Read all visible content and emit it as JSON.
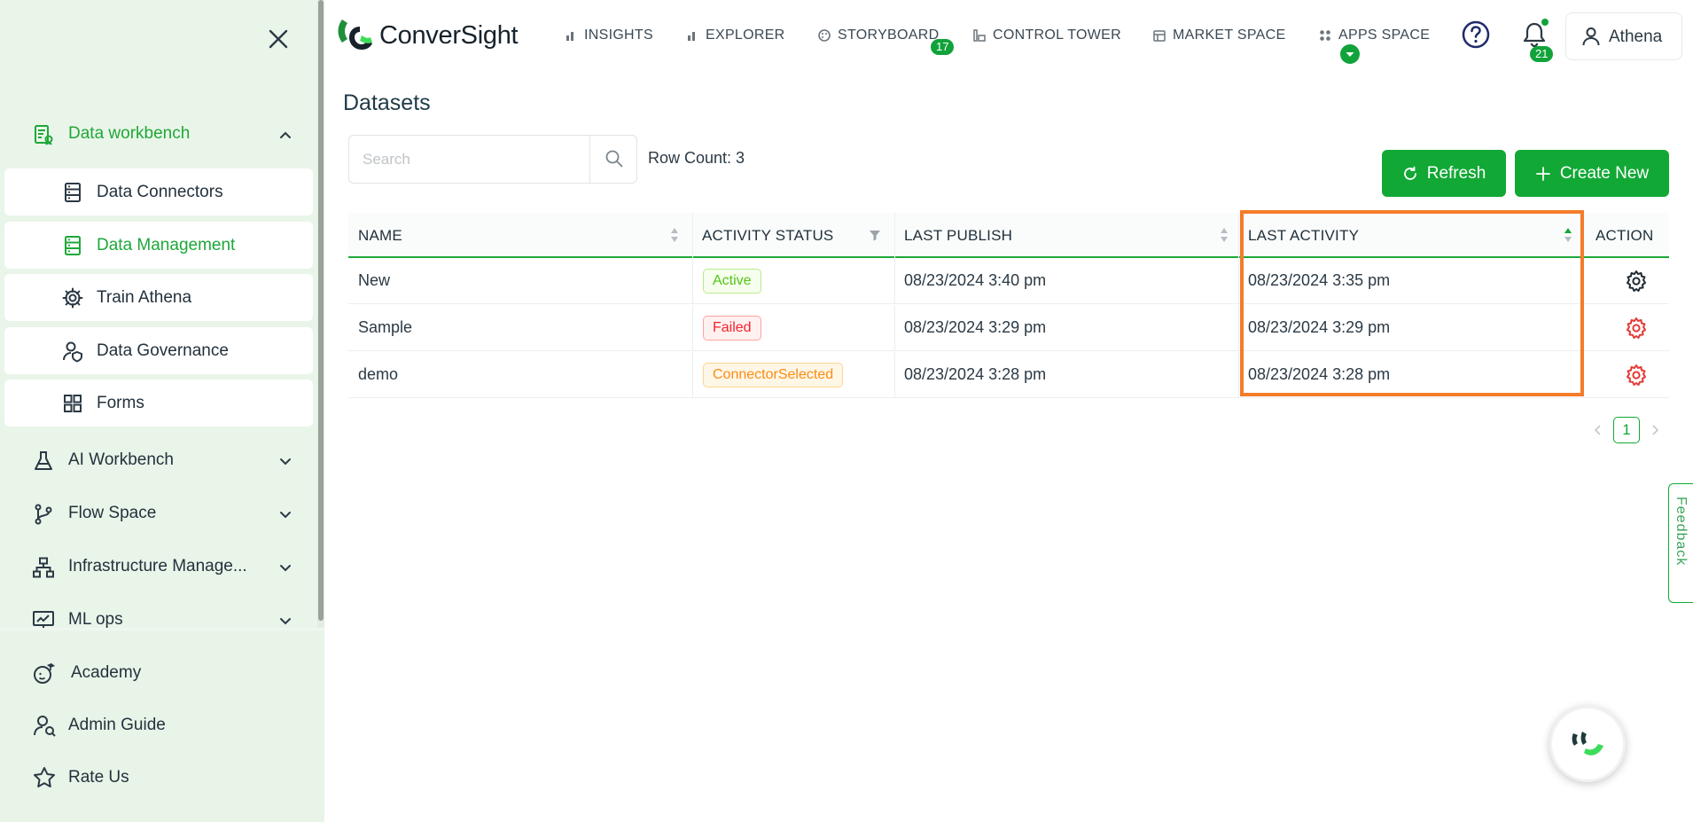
{
  "sidebar": {
    "groups": [
      {
        "label": "Data workbench",
        "icon": "data-workbench-icon",
        "open": true
      },
      {
        "label": "AI Workbench",
        "icon": "flask-icon"
      },
      {
        "label": "Flow Space",
        "icon": "branch-icon"
      },
      {
        "label": "Infrastructure Manage...",
        "icon": "sitemap-icon"
      },
      {
        "label": "ML ops",
        "icon": "monitor-chart-icon"
      }
    ],
    "sub_items": [
      {
        "label": "Data Connectors",
        "icon": "server-icon"
      },
      {
        "label": "Data Management",
        "icon": "server-icon",
        "active": true
      },
      {
        "label": "Train Athena",
        "icon": "gear-icon"
      },
      {
        "label": "Data Governance",
        "icon": "user-shield-icon"
      },
      {
        "label": "Forms",
        "icon": "grid-icon"
      }
    ],
    "bottom_items": [
      {
        "label": "Academy",
        "icon": "academy-icon"
      },
      {
        "label": "Admin Guide",
        "icon": "admin-guide-icon"
      },
      {
        "label": "Rate Us",
        "icon": "star-icon"
      }
    ]
  },
  "header": {
    "logo_text": "ConverSight",
    "nav": [
      {
        "label": "INSIGHTS",
        "icon": "bar-chart-icon"
      },
      {
        "label": "EXPLORER",
        "icon": "bar-chart-icon"
      },
      {
        "label": "STORYBOARD",
        "icon": "palette-icon",
        "badge": "17"
      },
      {
        "label": "CONTROL TOWER",
        "icon": "tower-icon"
      },
      {
        "label": "MARKET SPACE",
        "icon": "store-icon"
      },
      {
        "label": "APPS SPACE",
        "icon": "apps-icon"
      }
    ],
    "notification_count": "21",
    "user_name": "Athena"
  },
  "main": {
    "title": "Datasets",
    "search_placeholder": "Search",
    "row_count": "Row Count: 3",
    "refresh_label": "Refresh",
    "create_label": "Create New",
    "columns": [
      "NAME",
      "ACTIVITY STATUS",
      "LAST PUBLISH",
      "LAST ACTIVITY",
      "ACTION"
    ],
    "rows": [
      {
        "name": "New",
        "status": "Active",
        "last_publish": "08/23/2024 3:40 pm",
        "last_activity": "08/23/2024 3:35 pm"
      },
      {
        "name": "Sample",
        "status": "Failed",
        "last_publish": "08/23/2024 3:29 pm",
        "last_activity": "08/23/2024 3:29 pm"
      },
      {
        "name": "demo",
        "status": "ConnectorSelected",
        "last_publish": "08/23/2024 3:28 pm",
        "last_activity": "08/23/2024 3:28 pm"
      }
    ],
    "pagination": {
      "current": "1"
    }
  },
  "feedback_label": "Feedback",
  "colors": {
    "accent": "#12a835",
    "sidebar_bg": "#eaf5ea",
    "highlight": "#f47c2b",
    "status_active": "#52c41a",
    "status_failed": "#f5222d",
    "status_connector": "#fa8c16",
    "gear_failed": "#e53935"
  }
}
